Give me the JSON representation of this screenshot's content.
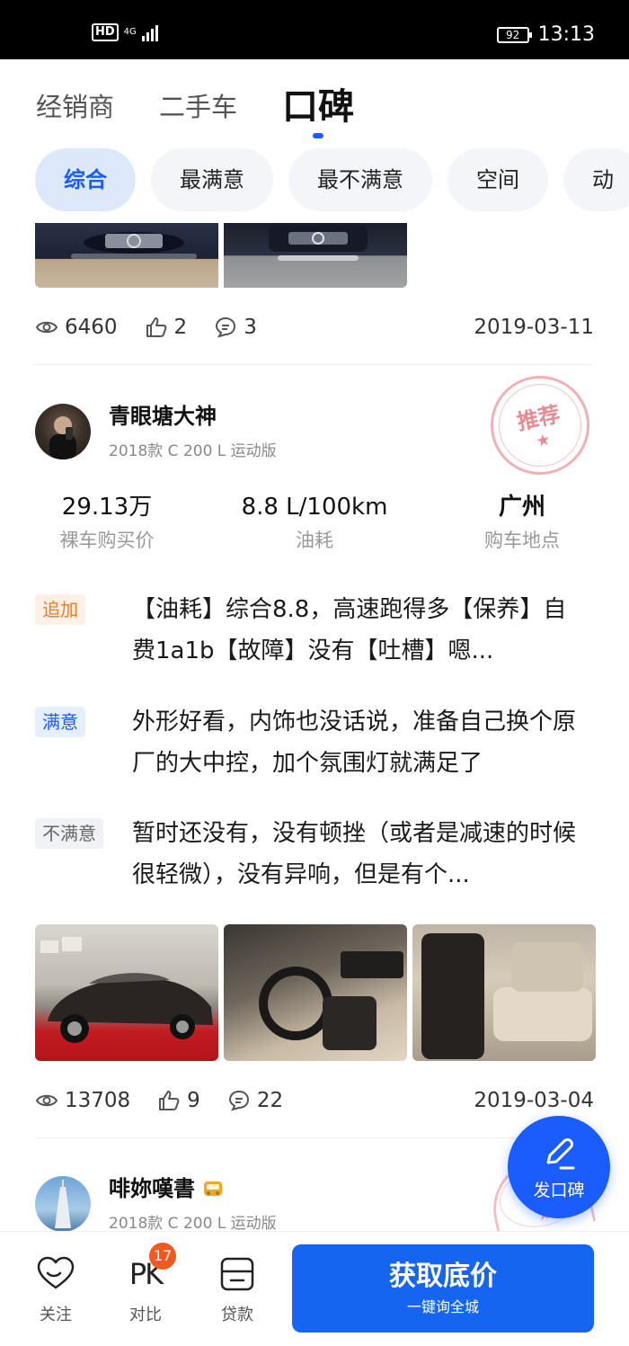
{
  "status_bar": {
    "hd": "HD",
    "network": "4G",
    "battery": "92",
    "time": "13:13"
  },
  "top_tabs": [
    {
      "label": "经销商"
    },
    {
      "label": "二手车"
    },
    {
      "label": "口碑"
    }
  ],
  "filters": [
    {
      "label": "综合"
    },
    {
      "label": "最满意"
    },
    {
      "label": "最不满意"
    },
    {
      "label": "空间"
    },
    {
      "label": "动"
    }
  ],
  "post1": {
    "views": "6460",
    "likes": "2",
    "comments": "3",
    "date": "2019-03-11"
  },
  "post2": {
    "author": "青眼塘大神",
    "model": "2018款 C 200 L 运动版",
    "stamp": "推荐",
    "metrics": [
      {
        "value": "29.13万",
        "label": "裸车购买价"
      },
      {
        "value": "8.8 L/100km",
        "label": "油耗"
      },
      {
        "value": "广州",
        "label": "购车地点"
      }
    ],
    "reviews": [
      {
        "tag": "追加",
        "text": "【油耗】综合8.8，高速跑得多【保养】自费1a1b【故障】没有【吐槽】嗯..."
      },
      {
        "tag": "满意",
        "text": "外形好看，内饰也没话说，准备自己换个原厂的大中控，加个氛围灯就满足了"
      },
      {
        "tag": "不满意",
        "text": "暂时还没有，没有顿挫（或者是减速的时候很轻微），没有异响，但是有个..."
      }
    ],
    "views": "13708",
    "likes": "9",
    "comments": "22",
    "date": "2019-03-04"
  },
  "post3": {
    "author": "啡妳嘆書",
    "model": "2018款 C 200 L 运动版"
  },
  "fab": {
    "label": "发口碑"
  },
  "bottom_bar": {
    "follow": "关注",
    "compare": "对比",
    "compare_icon": "PK",
    "compare_badge": "17",
    "loan": "贷款",
    "cta_main": "获取底价",
    "cta_sub": "一键询全城"
  },
  "colors": {
    "accent": "#1a5cff",
    "cta": "#1565f0",
    "badge": "#f05a22"
  }
}
